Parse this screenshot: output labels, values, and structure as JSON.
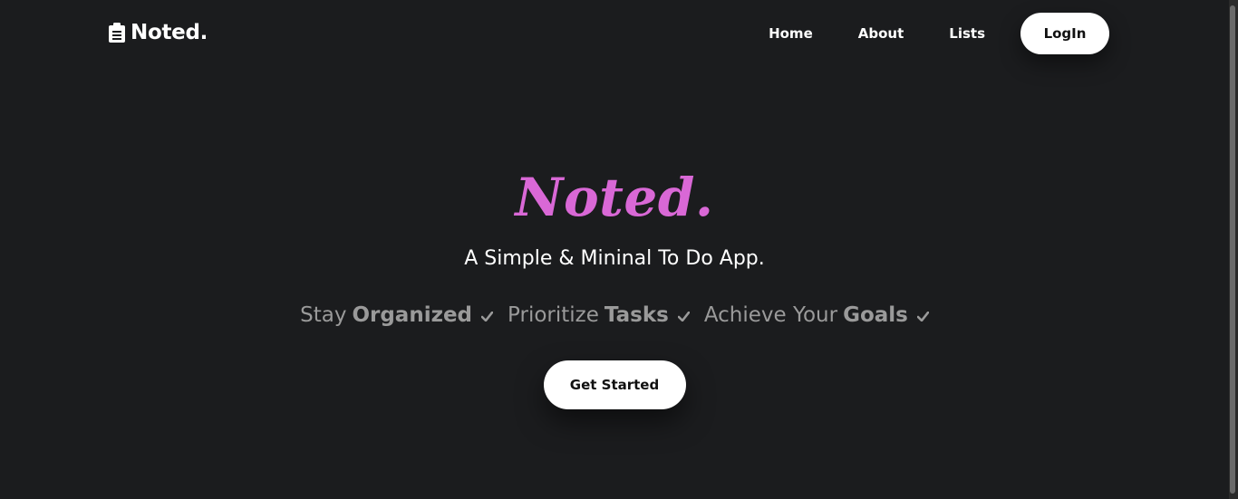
{
  "header": {
    "brand": "Noted.",
    "brand_icon": "clipboard-icon",
    "nav": [
      {
        "label": "Home"
      },
      {
        "label": "About"
      },
      {
        "label": "Lists"
      }
    ],
    "login_label": "LogIn"
  },
  "hero": {
    "title": "Noted.",
    "subtitle": "A Simple & Mininal To Do App.",
    "taglines": [
      {
        "light": "Stay",
        "bold": "Organized",
        "icon": "check-icon"
      },
      {
        "light": "Prioritize",
        "bold": "Tasks",
        "icon": "check-icon"
      },
      {
        "light": "Achieve Your",
        "bold": "Goals",
        "icon": "check-icon"
      }
    ],
    "cta_label": "Get Started"
  },
  "colors": {
    "background": "#1b1c1e",
    "accent": "#d968d6",
    "text": "#ffffff",
    "muted": "#9a9a9a",
    "button_bg": "#ffffff"
  }
}
